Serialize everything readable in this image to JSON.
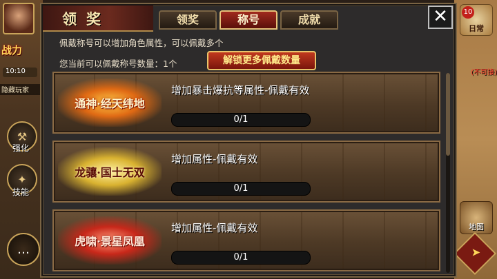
{
  "left_hud": {
    "power_label": "战力",
    "timer": "10:10",
    "hidden_play": "隐藏玩家",
    "enhance_label": "强化",
    "skill_label": "技能",
    "chat_icon": "…"
  },
  "right_hud": {
    "daily_count": "10",
    "daily_label": "日常",
    "unclaimable": "(不可接)",
    "map_label": "地图"
  },
  "panel": {
    "title": "领奖",
    "tabs": [
      {
        "label": "领奖",
        "active": false
      },
      {
        "label": "称号",
        "active": true
      },
      {
        "label": "成就",
        "active": false
      }
    ],
    "close_glyph": "✕",
    "info_text": "佩戴称号可以增加角色属性，可以佩戴多个",
    "slots_text": "您当前可以佩戴称号数量：1个",
    "unlock_button": "解锁更多佩戴数量",
    "titles": [
      {
        "badge": "通神·经天纬地",
        "badge_style": "fire",
        "desc": "增加暴击爆抗等属性-佩戴有效",
        "progress_text": "0/1",
        "progress": 0
      },
      {
        "badge": "龙骧·国士无双",
        "badge_style": "dragon",
        "desc": "增加属性-佩戴有效",
        "progress_text": "0/1",
        "progress": 0
      },
      {
        "badge": "虎啸·景星凤凰",
        "badge_style": "tiger",
        "desc": "增加属性-佩戴有效",
        "progress_text": "0/1",
        "progress": 0
      }
    ]
  }
}
